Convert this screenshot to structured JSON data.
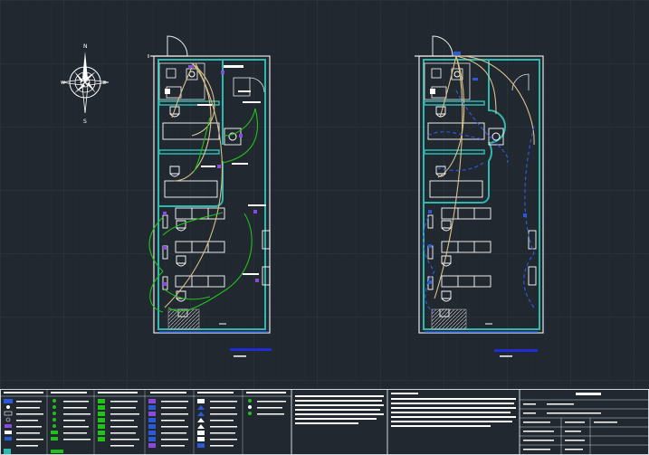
{
  "compass": {
    "north_label": "N",
    "south_label": "S",
    "east_label": "E",
    "west_label": "W"
  },
  "colors": {
    "background": "#212830",
    "grid": "#2c3540",
    "wall": "#e6e6e6",
    "teal_wall": "#2fb8b0",
    "circuit_tan": "#d8c08a",
    "circuit_green": "#22c01a",
    "circuit_blue": "#2a5ad8",
    "device_purple": "#8a4ae0",
    "title_bar": "#1e2bd6",
    "titleblock_line": "#cfd6dc"
  },
  "sheets": [
    {
      "name": "left-plan",
      "circuit": "green"
    },
    {
      "name": "right-plan",
      "circuit": "blue"
    }
  ]
}
